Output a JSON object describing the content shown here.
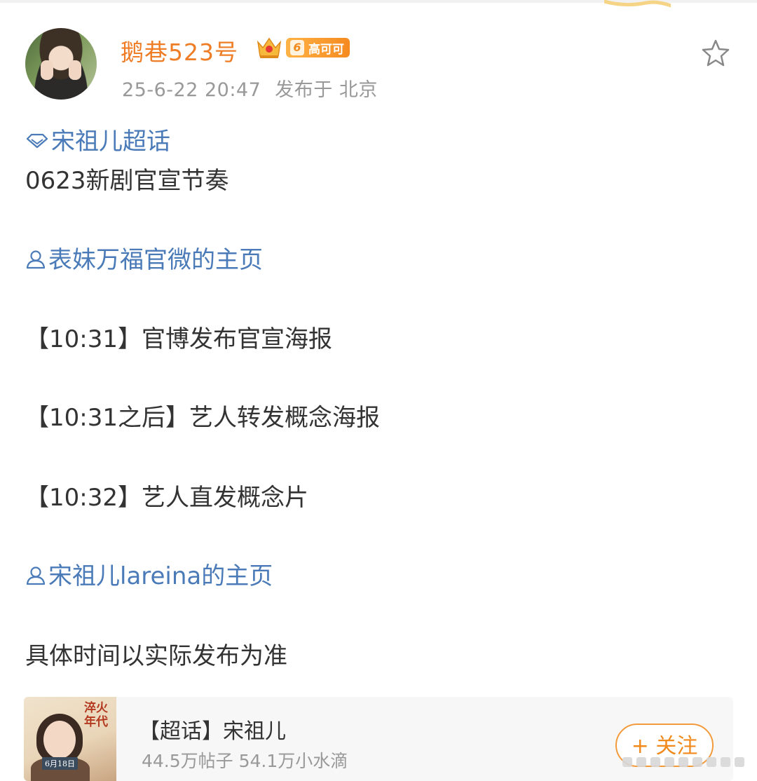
{
  "author": {
    "name": "鹅巷523号",
    "level": "6",
    "badge_text": "高可可"
  },
  "post_meta": {
    "time": "25-6-22 20:47",
    "location": "发布于 北京"
  },
  "content": {
    "topic_link": "宋祖儿超话",
    "line1": "0623新剧官宣节奏",
    "mention1": "表妹万福官微的主页",
    "line2": "【10:31】官博发布官宣海报",
    "line3": "【10:31之后】艺人转发概念海报",
    "line4": "【10:32】艺人直发概念片",
    "mention2": "宋祖儿lareina的主页",
    "line5": "具体时间以实际发布为准"
  },
  "card": {
    "poster_title": "淬火年代",
    "poster_date": "6月18日",
    "title": "【超话】宋祖儿",
    "stats": "44.5万帖子 54.1万小水滴",
    "follow_label": "+ 关注"
  },
  "colors": {
    "username": "#ee7d26",
    "link": "#4a7bb8",
    "meta": "#999999",
    "follow": "#f08a1d"
  },
  "icons": [
    "favorite-star-icon",
    "crown-icon",
    "super-topic-diamond-icon",
    "user-mention-icon"
  ]
}
